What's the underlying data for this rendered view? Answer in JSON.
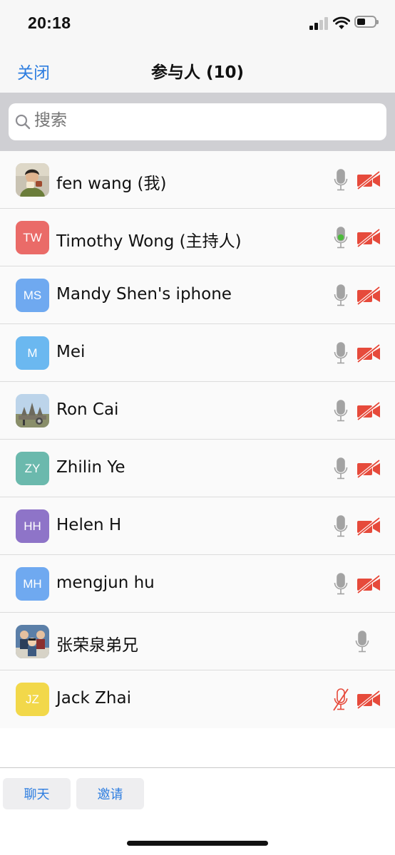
{
  "status_bar": {
    "time": "20:18"
  },
  "nav": {
    "close_label": "关闭",
    "title": "参与人 (10)"
  },
  "search": {
    "placeholder": "搜索",
    "icon": "search-icon"
  },
  "participants": [
    {
      "name": "fen wang (我)",
      "avatar_type": "photo",
      "photo": "woman-eating",
      "mic": "idle",
      "video": "off"
    },
    {
      "name": "Timothy Wong (主持人)",
      "avatar_type": "initials",
      "initials": "TW",
      "color": "#ea6b68",
      "mic": "speaking",
      "video": "off"
    },
    {
      "name": "Mandy Shen's iphone",
      "avatar_type": "initials",
      "initials": "MS",
      "color": "#6fa9f0",
      "mic": "idle",
      "video": "off"
    },
    {
      "name": "Mei",
      "avatar_type": "initials",
      "initials": "M",
      "color": "#6bb8f0",
      "mic": "idle",
      "video": "off"
    },
    {
      "name": "Ron Cai",
      "avatar_type": "photo",
      "photo": "temple-landscape",
      "mic": "idle",
      "video": "off"
    },
    {
      "name": "Zhilin Ye",
      "avatar_type": "initials",
      "initials": "ZY",
      "color": "#6bb9ad",
      "mic": "idle",
      "video": "off"
    },
    {
      "name": "Helen H",
      "avatar_type": "initials",
      "initials": "HH",
      "color": "#8e74c8",
      "mic": "idle",
      "video": "off"
    },
    {
      "name": "mengjun hu",
      "avatar_type": "initials",
      "initials": "MH",
      "color": "#6fa9f0",
      "mic": "idle",
      "video": "off"
    },
    {
      "name": "张荣泉弟兄",
      "avatar_type": "photo",
      "photo": "cartoon-group",
      "mic": "idle",
      "video": "none"
    },
    {
      "name": "Jack Zhai",
      "avatar_type": "initials",
      "initials": "JZ",
      "color": "#f2d84a",
      "mic": "muted",
      "video": "off"
    }
  ],
  "toolbar": {
    "chat_label": "聊天",
    "invite_label": "邀请"
  },
  "colors": {
    "accent": "#2d7de0",
    "muted_red": "#e64a3b",
    "speaking_green": "#4cbb3b",
    "mic_gray": "#a3a3a3"
  }
}
